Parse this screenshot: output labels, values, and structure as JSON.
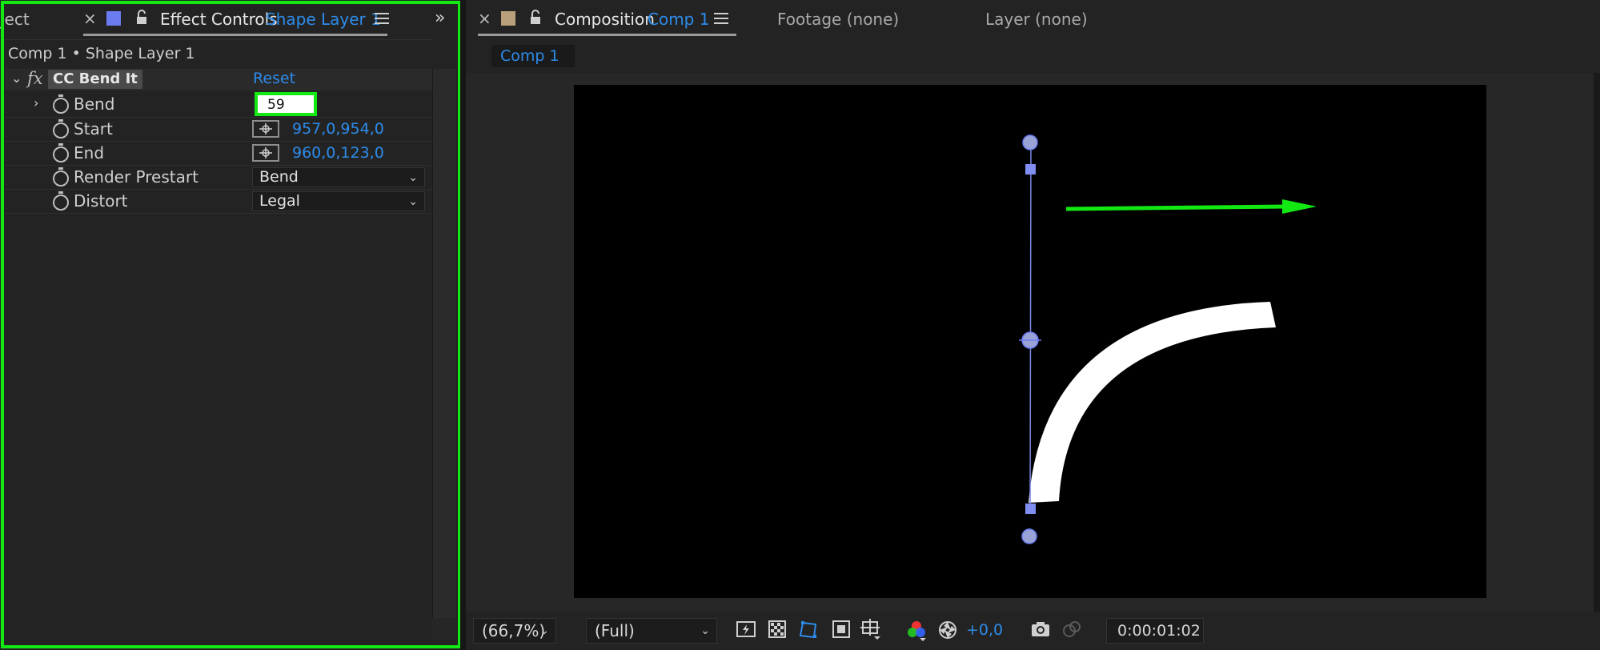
{
  "left_panel": {
    "tab_project_partial": "ject",
    "tab_close": "×",
    "tab_effect_controls": "Effect Controls",
    "tab_layer_name": "Shape Layer 1",
    "breadcrumb": "Comp 1 • Shape Layer 1",
    "effect_name": "CC Bend It",
    "reset_label": "Reset",
    "fx_label": "fx",
    "properties": {
      "bend": {
        "label": "Bend",
        "value": "59"
      },
      "start": {
        "label": "Start",
        "value": "957,0,954,0"
      },
      "end": {
        "label": "End",
        "value": "960,0,123,0"
      },
      "render_prestart": {
        "label": "Render Prestart",
        "value": "Bend"
      },
      "distort": {
        "label": "Distort",
        "value": "Legal"
      }
    }
  },
  "right_panel": {
    "tab_close": "×",
    "tab_composition": "Composition",
    "tab_comp_name": "Comp 1",
    "tab_footage": "Footage (none)",
    "tab_layer": "Layer (none)",
    "comp_chip": "Comp 1",
    "zoom": "(66,7%)",
    "resolution": "(Full)",
    "exposure": "+0,0",
    "timecode": "0:00:01:02"
  },
  "colors": {
    "highlight_green": "#12e812",
    "accent_blue": "#2d8ceb",
    "layer_label": "#6a7cf0",
    "comp_icon": "#b8a07a"
  }
}
